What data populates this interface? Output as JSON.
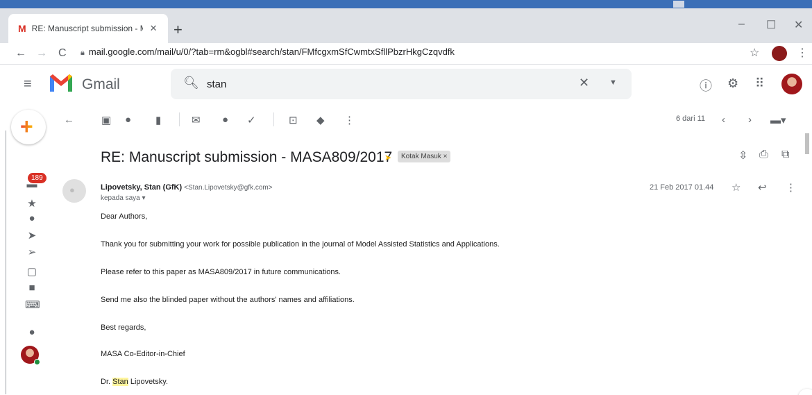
{
  "browser": {
    "tab_title": "RE: Manuscript submission - MASA809/2017",
    "tab_close": "✕",
    "new_tab": "+",
    "url": "mail.google.com/mail/u/0/?tab=rm&ogbl#search/stan/FMfcgxmSfCwmtxSfllPbzrHkgCzqvdfk"
  },
  "header": {
    "product_name": "Gmail",
    "search_value": "stan"
  },
  "left_rail": {
    "unread_count": "189"
  },
  "toolbar": {
    "pagination": "6 dari 11"
  },
  "message": {
    "subject": "RE: Manuscript submission - MASA809/2017",
    "label": "Kotak Masuk ×",
    "sender_name": "Lipovetsky, Stan (GfK)",
    "sender_email": "<Stan.Lipovetsky@gfk.com>",
    "recipient": "kepada saya ▾",
    "date": "21 Feb 2017 01.44",
    "body": {
      "greeting": "Dear Authors,",
      "line1": "Thank you for submitting your work for possible publication in the journal of Model Assisted Statistics and Applications.",
      "line2": "Please refer to this paper as MASA809/2017 in future communications.",
      "line3": "Send me also the blinded paper without the authors' names and affiliations.",
      "closing": "Best regards,",
      "role": "MASA Co-Editor-in-Chief",
      "signature_prefix": "Dr. ",
      "signature_highlight": "Stan",
      "signature_suffix": " Lipovetsky."
    }
  },
  "colors": {
    "accent_red": "#d93025",
    "label_yellow": "#f4b400",
    "highlight": "#fff59d"
  }
}
